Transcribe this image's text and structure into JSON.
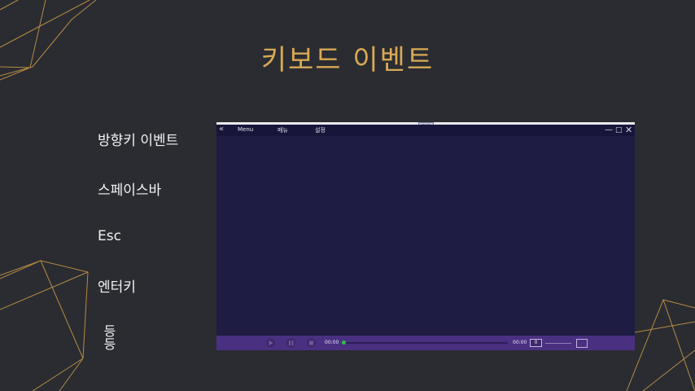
{
  "slide": {
    "title": "키보드 이벤트",
    "bullets": [
      "방향키 이벤트",
      "스페이스바",
      "Esc",
      "엔터키",
      "등등"
    ]
  },
  "player": {
    "window_tab_label": "Ubuntu",
    "menu": {
      "back_icon": "chevron-left-double-icon",
      "items": [
        "Menu",
        "메뉴",
        "설정"
      ]
    },
    "window_controls": {
      "minimize": "—",
      "maximize": "□",
      "close": "✕"
    },
    "controls": {
      "current_time": "00:00",
      "total_time": "00:00",
      "progress": 0,
      "volume_value": "0",
      "buttons": [
        "play-icon",
        "pause-icon",
        "stop-icon"
      ]
    }
  },
  "colors": {
    "background": "#2a2c31",
    "title": "#d8a955",
    "decoration_lines": "#b58a45",
    "player_bg": "#1e1c42",
    "control_bar": "#4a3081",
    "seek_knob": "#2fbf4b"
  }
}
